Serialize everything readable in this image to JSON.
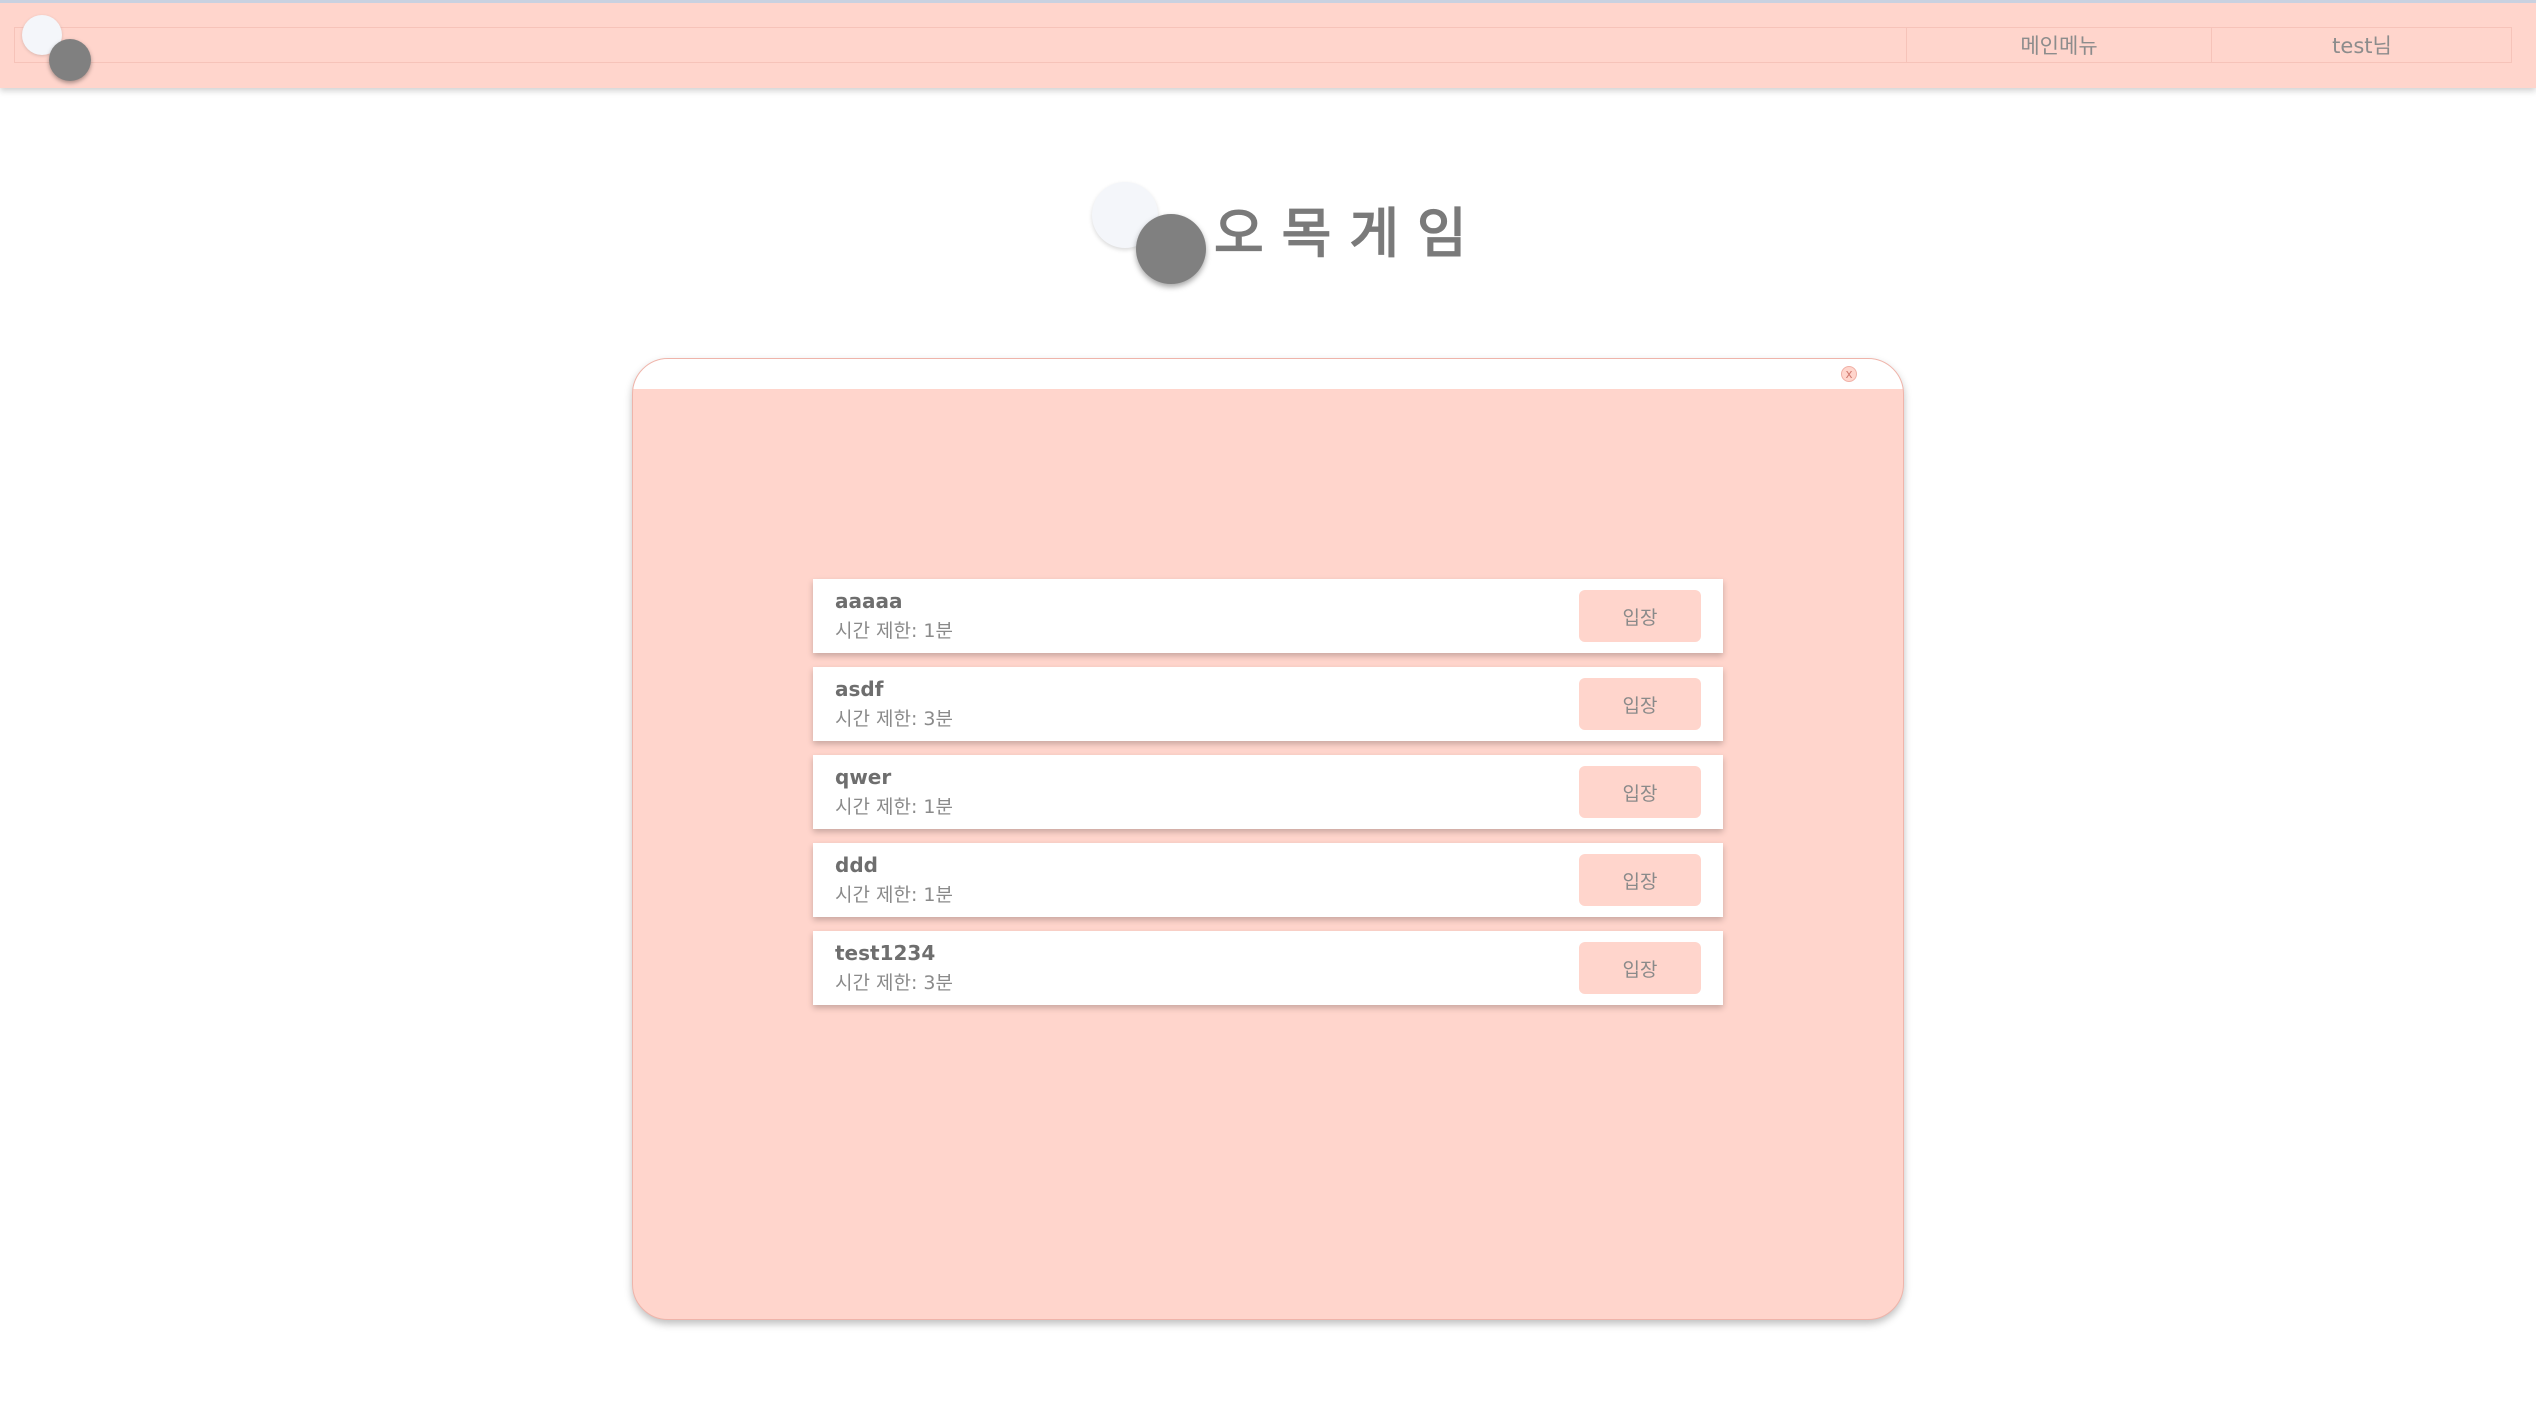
{
  "nav": {
    "main_menu": "메인메뉴",
    "user": "test님"
  },
  "title": "오목게임",
  "modal": {
    "close_label": "x",
    "rooms": [
      {
        "name": "aaaaa",
        "time": "시간 제한: 1분",
        "button": "입장"
      },
      {
        "name": "asdf",
        "time": "시간 제한: 3분",
        "button": "입장"
      },
      {
        "name": "qwer",
        "time": "시간 제한: 1분",
        "button": "입장"
      },
      {
        "name": "ddd",
        "time": "시간 제한: 1분",
        "button": "입장"
      },
      {
        "name": "test1234",
        "time": "시간 제한: 3분",
        "button": "입장"
      }
    ]
  },
  "colors": {
    "accent": "#ffd5cc",
    "text": "#7a7a7a",
    "stone_black": "#808080",
    "stone_white": "#f4f6fa"
  }
}
